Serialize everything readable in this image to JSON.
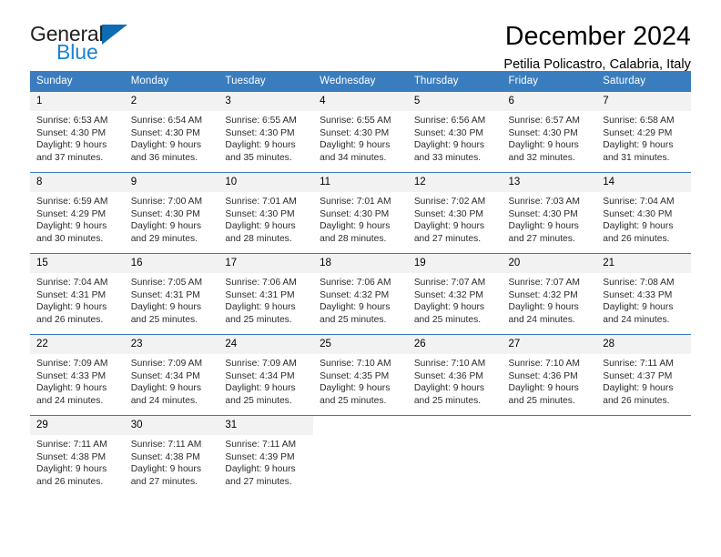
{
  "brand": {
    "name_line1": "General",
    "name_line2": "Blue",
    "primary_color": "#0d6cb3",
    "secondary_color": "#1b82d1"
  },
  "header": {
    "title": "December 2024",
    "subtitle": "Petilia Policastro, Calabria, Italy"
  },
  "calendar": {
    "header_bg": "#3a7dbf",
    "daynum_bg": "#f2f2f2",
    "weekday_headers": [
      "Sunday",
      "Monday",
      "Tuesday",
      "Wednesday",
      "Thursday",
      "Friday",
      "Saturday"
    ],
    "weeks": [
      [
        {
          "day": "1",
          "info": "Sunrise: 6:53 AM\nSunset: 4:30 PM\nDaylight: 9 hours\nand 37 minutes."
        },
        {
          "day": "2",
          "info": "Sunrise: 6:54 AM\nSunset: 4:30 PM\nDaylight: 9 hours\nand 36 minutes."
        },
        {
          "day": "3",
          "info": "Sunrise: 6:55 AM\nSunset: 4:30 PM\nDaylight: 9 hours\nand 35 minutes."
        },
        {
          "day": "4",
          "info": "Sunrise: 6:55 AM\nSunset: 4:30 PM\nDaylight: 9 hours\nand 34 minutes."
        },
        {
          "day": "5",
          "info": "Sunrise: 6:56 AM\nSunset: 4:30 PM\nDaylight: 9 hours\nand 33 minutes."
        },
        {
          "day": "6",
          "info": "Sunrise: 6:57 AM\nSunset: 4:30 PM\nDaylight: 9 hours\nand 32 minutes."
        },
        {
          "day": "7",
          "info": "Sunrise: 6:58 AM\nSunset: 4:29 PM\nDaylight: 9 hours\nand 31 minutes."
        }
      ],
      [
        {
          "day": "8",
          "info": "Sunrise: 6:59 AM\nSunset: 4:29 PM\nDaylight: 9 hours\nand 30 minutes."
        },
        {
          "day": "9",
          "info": "Sunrise: 7:00 AM\nSunset: 4:30 PM\nDaylight: 9 hours\nand 29 minutes."
        },
        {
          "day": "10",
          "info": "Sunrise: 7:01 AM\nSunset: 4:30 PM\nDaylight: 9 hours\nand 28 minutes."
        },
        {
          "day": "11",
          "info": "Sunrise: 7:01 AM\nSunset: 4:30 PM\nDaylight: 9 hours\nand 28 minutes."
        },
        {
          "day": "12",
          "info": "Sunrise: 7:02 AM\nSunset: 4:30 PM\nDaylight: 9 hours\nand 27 minutes."
        },
        {
          "day": "13",
          "info": "Sunrise: 7:03 AM\nSunset: 4:30 PM\nDaylight: 9 hours\nand 27 minutes."
        },
        {
          "day": "14",
          "info": "Sunrise: 7:04 AM\nSunset: 4:30 PM\nDaylight: 9 hours\nand 26 minutes."
        }
      ],
      [
        {
          "day": "15",
          "info": "Sunrise: 7:04 AM\nSunset: 4:31 PM\nDaylight: 9 hours\nand 26 minutes."
        },
        {
          "day": "16",
          "info": "Sunrise: 7:05 AM\nSunset: 4:31 PM\nDaylight: 9 hours\nand 25 minutes."
        },
        {
          "day": "17",
          "info": "Sunrise: 7:06 AM\nSunset: 4:31 PM\nDaylight: 9 hours\nand 25 minutes."
        },
        {
          "day": "18",
          "info": "Sunrise: 7:06 AM\nSunset: 4:32 PM\nDaylight: 9 hours\nand 25 minutes."
        },
        {
          "day": "19",
          "info": "Sunrise: 7:07 AM\nSunset: 4:32 PM\nDaylight: 9 hours\nand 25 minutes."
        },
        {
          "day": "20",
          "info": "Sunrise: 7:07 AM\nSunset: 4:32 PM\nDaylight: 9 hours\nand 24 minutes."
        },
        {
          "day": "21",
          "info": "Sunrise: 7:08 AM\nSunset: 4:33 PM\nDaylight: 9 hours\nand 24 minutes."
        }
      ],
      [
        {
          "day": "22",
          "info": "Sunrise: 7:09 AM\nSunset: 4:33 PM\nDaylight: 9 hours\nand 24 minutes."
        },
        {
          "day": "23",
          "info": "Sunrise: 7:09 AM\nSunset: 4:34 PM\nDaylight: 9 hours\nand 24 minutes."
        },
        {
          "day": "24",
          "info": "Sunrise: 7:09 AM\nSunset: 4:34 PM\nDaylight: 9 hours\nand 25 minutes."
        },
        {
          "day": "25",
          "info": "Sunrise: 7:10 AM\nSunset: 4:35 PM\nDaylight: 9 hours\nand 25 minutes."
        },
        {
          "day": "26",
          "info": "Sunrise: 7:10 AM\nSunset: 4:36 PM\nDaylight: 9 hours\nand 25 minutes."
        },
        {
          "day": "27",
          "info": "Sunrise: 7:10 AM\nSunset: 4:36 PM\nDaylight: 9 hours\nand 25 minutes."
        },
        {
          "day": "28",
          "info": "Sunrise: 7:11 AM\nSunset: 4:37 PM\nDaylight: 9 hours\nand 26 minutes."
        }
      ],
      [
        {
          "day": "29",
          "info": "Sunrise: 7:11 AM\nSunset: 4:38 PM\nDaylight: 9 hours\nand 26 minutes."
        },
        {
          "day": "30",
          "info": "Sunrise: 7:11 AM\nSunset: 4:38 PM\nDaylight: 9 hours\nand 27 minutes."
        },
        {
          "day": "31",
          "info": "Sunrise: 7:11 AM\nSunset: 4:39 PM\nDaylight: 9 hours\nand 27 minutes."
        },
        {
          "day": "",
          "info": ""
        },
        {
          "day": "",
          "info": ""
        },
        {
          "day": "",
          "info": ""
        },
        {
          "day": "",
          "info": ""
        }
      ]
    ]
  }
}
